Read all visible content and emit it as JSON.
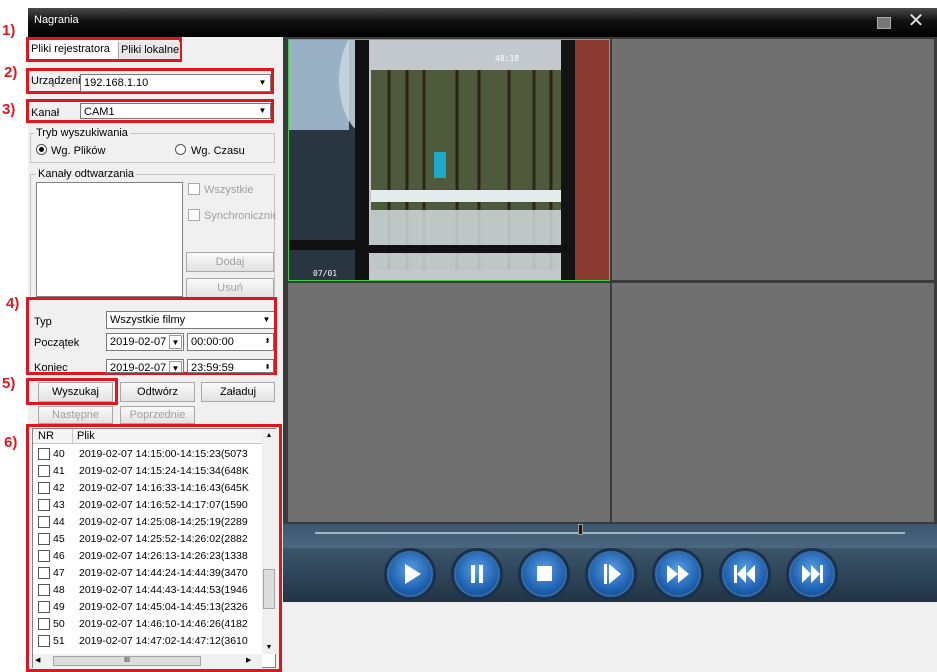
{
  "window": {
    "title": "Nagrania"
  },
  "annotations": [
    "1)",
    "2)",
    "3)",
    "4)",
    "5)",
    "6)"
  ],
  "tabs": {
    "recorder_files": "Pliki rejestratora",
    "local_files": "Pliki lokalne"
  },
  "device": {
    "label": "Urządzenie",
    "value": "192.168.1.10"
  },
  "channel": {
    "label": "Kanał",
    "value": "CAM1"
  },
  "search_mode": {
    "legend": "Tryb wyszukiwania",
    "by_files": "Wg. Plików",
    "by_time": "Wg. Czasu"
  },
  "playback_channels": {
    "legend": "Kanały odtwarzania",
    "all": "Wszystkie",
    "sync": "Synchronicznie",
    "add": "Dodaj",
    "remove": "Usuń"
  },
  "filters": {
    "type_label": "Typ",
    "type_value": "Wszystkie filmy",
    "start_label": "Początek",
    "start_date": "2019-02-07",
    "start_time": "00:00:00",
    "end_label": "Koniec",
    "end_date": "2019-02-07",
    "end_time": "23:59:59"
  },
  "actions": {
    "search": "Wyszukaj",
    "play": "Odtwórz",
    "download": "Załaduj",
    "next": "Następne",
    "previous": "Poprzednie"
  },
  "file_list": {
    "headers": [
      "NR",
      "Plik"
    ],
    "rows": [
      {
        "nr": "40",
        "file": "2019-02-07 14:15:00-14:15:23(5073"
      },
      {
        "nr": "41",
        "file": "2019-02-07 14:15:24-14:15:34(648K"
      },
      {
        "nr": "42",
        "file": "2019-02-07 14:16:33-14:16:43(645K"
      },
      {
        "nr": "43",
        "file": "2019-02-07 14:16:52-14:17:07(1590"
      },
      {
        "nr": "44",
        "file": "2019-02-07 14:25:08-14:25:19(2289"
      },
      {
        "nr": "45",
        "file": "2019-02-07 14:25:52-14:26:02(2882"
      },
      {
        "nr": "46",
        "file": "2019-02-07 14:26:13-14:26:23(1338"
      },
      {
        "nr": "47",
        "file": "2019-02-07 14:44:24-14:44:39(3470"
      },
      {
        "nr": "48",
        "file": "2019-02-07 14:44:43-14:44:53(1946"
      },
      {
        "nr": "49",
        "file": "2019-02-07 14:45:04-14:45:13(2326"
      },
      {
        "nr": "50",
        "file": "2019-02-07 14:46:10-14:46:26(4182"
      },
      {
        "nr": "51",
        "file": "2019-02-07 14:47:02-14:47:12(3610"
      }
    ],
    "hscroll_grip": "III"
  },
  "video": {
    "timestamp_fragment": "48:18",
    "overlay_fragment": "07/01"
  },
  "playback": {
    "progress": 0.45
  },
  "colors": {
    "annotation_red": "#e0161f",
    "button_blue": "#1d5fb0",
    "video_bg": "#707070"
  }
}
